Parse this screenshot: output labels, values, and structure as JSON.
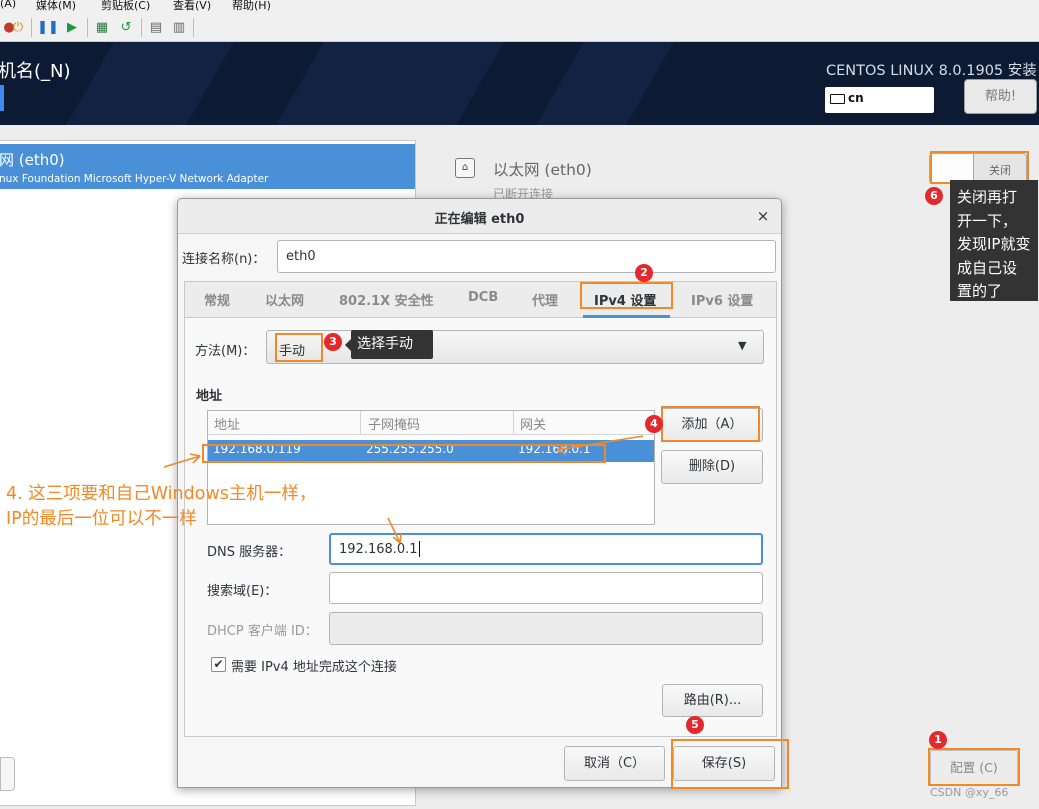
{
  "menubar": {
    "items": [
      "(A)",
      "媒体(M)",
      "剪贴板(C)",
      "查看(V)",
      "帮助(H)"
    ]
  },
  "header": {
    "title": "机名(_N)",
    "product": "CENTOS LINUX 8.0.1905 安装",
    "keyboard_layout": "cn",
    "help_label": "帮助!"
  },
  "device_list": {
    "selected_name": "网 (eth0)",
    "selected_desc": "nux Foundation Microsoft Hyper-V Network Adapter"
  },
  "device_detail": {
    "title": "以太网 (eth0)",
    "status": "已断开连接",
    "toggle_label": "关闭",
    "config_label": "配置 (C)"
  },
  "dialog": {
    "title": "正在编辑 eth0",
    "close_glyph": "×",
    "conn_name_label": "连接名称(n)：",
    "conn_name_value": "eth0",
    "tabs": [
      "常规",
      "以太网",
      "802.1X 安全性",
      "DCB",
      "代理",
      "IPv4 设置",
      "IPv6 设置"
    ],
    "method_label": "方法(M)：",
    "method_value": "手动",
    "address_heading": "地址",
    "columns": [
      "地址",
      "子网掩码",
      "网关"
    ],
    "row": {
      "address": "192.168.0.119",
      "netmask": "255.255.255.0",
      "gateway": "192.168.0.1"
    },
    "add_label": "添加（A）",
    "delete_label": "删除(D)",
    "dns_label": "DNS 服务器：",
    "dns_value": "192.168.0.1",
    "search_label": "搜索域(E)：",
    "dhcp_label": "DHCP 客户端 ID：",
    "require_label": "需要 IPv4 地址完成这个连接",
    "require_checked": "✔",
    "routes_label": "路由(R)...",
    "cancel_label": "取消（C）",
    "save_label": "保存(S)"
  },
  "annotations": {
    "badges": [
      "1",
      "2",
      "3",
      "4",
      "5",
      "6"
    ],
    "tip3": "选择手动",
    "tip6": "关闭再打开一下，发现IP就变成自己设置的了",
    "note4_line1": "4. 这三项要和自己Windows主机一样，",
    "note4_line2": "IP的最后一位可以不一样",
    "color": "#f08a28"
  },
  "watermark": "CSDN @xy_66"
}
